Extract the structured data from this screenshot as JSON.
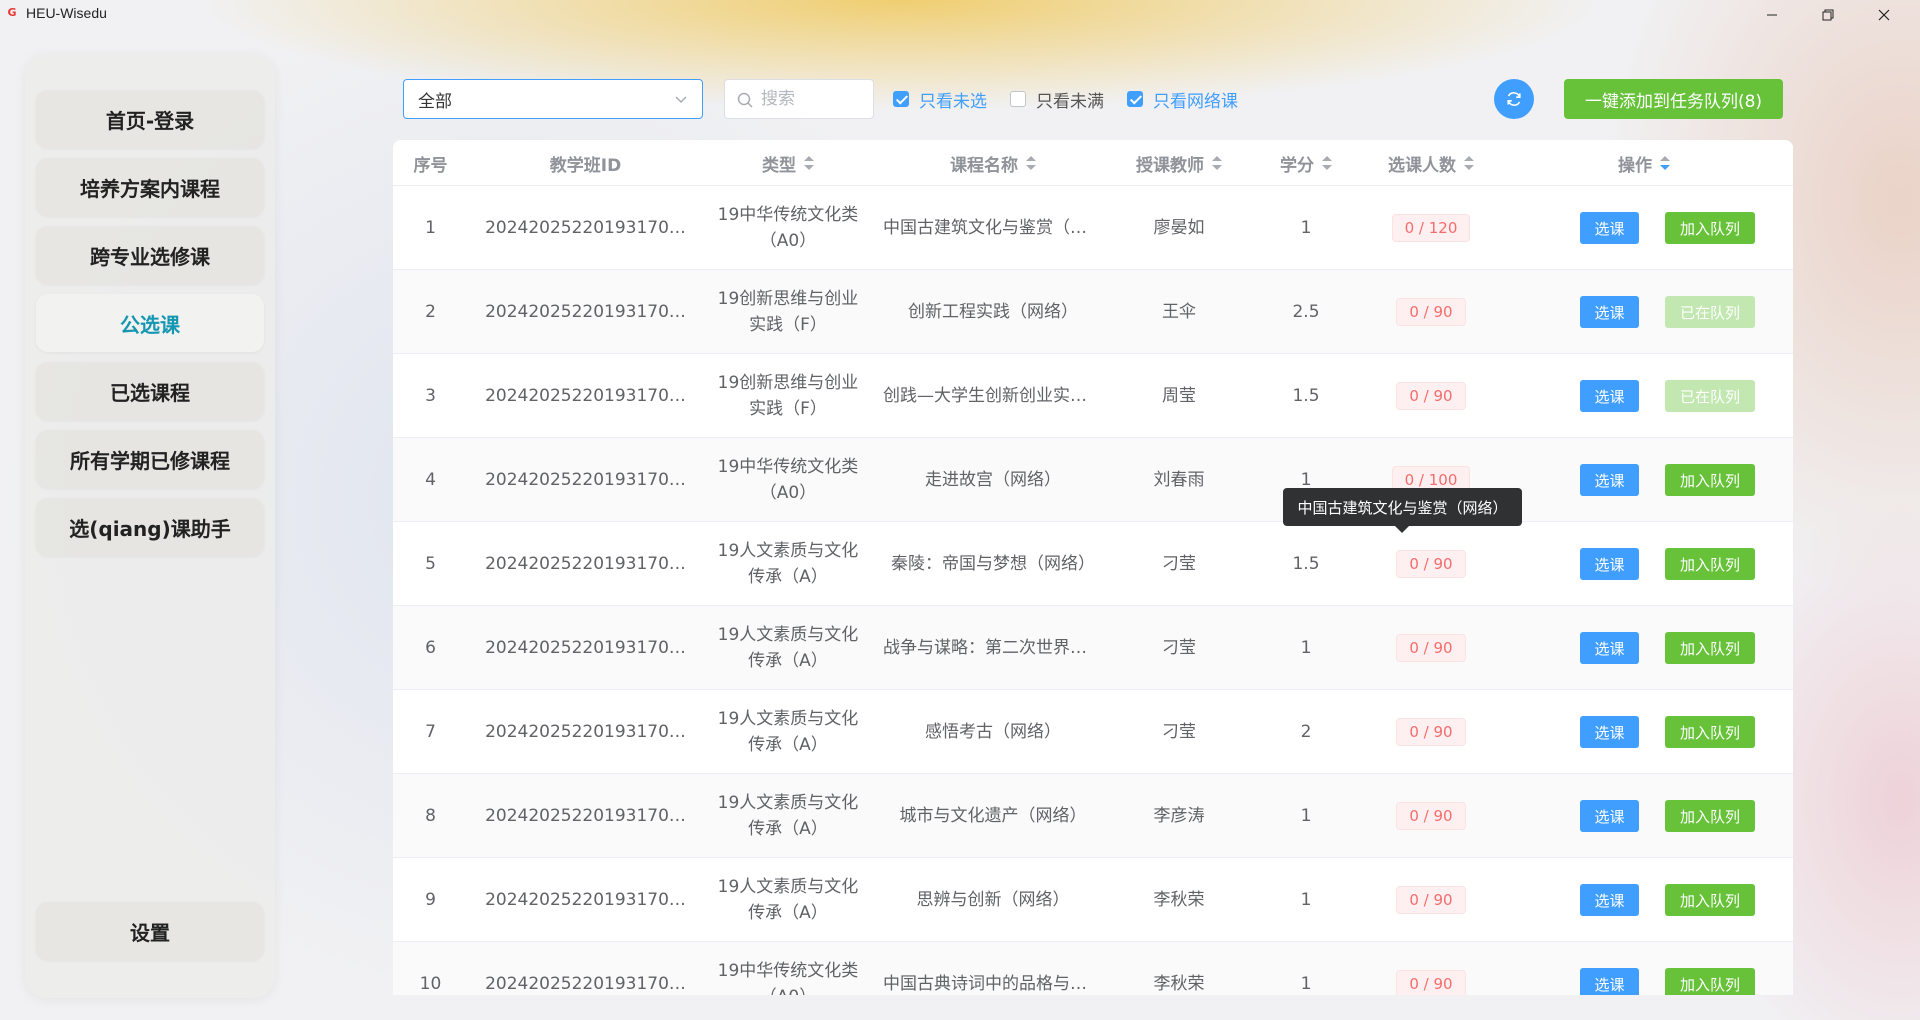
{
  "window": {
    "title": "HEU-Wisedu",
    "logo": "G"
  },
  "sidebar": {
    "items": [
      {
        "label": "首页-登录",
        "active": false
      },
      {
        "label": "培养方案内课程",
        "active": false
      },
      {
        "label": "跨专业选修课",
        "active": false
      },
      {
        "label": "公选课",
        "active": true
      },
      {
        "label": "已选课程",
        "active": false
      },
      {
        "label": "所有学期已修课程",
        "active": false
      },
      {
        "label": "选(qiang)课助手",
        "active": false
      }
    ],
    "settings_label": "设置"
  },
  "toolbar": {
    "filter_value": "全部",
    "search_placeholder": "搜索",
    "checkboxes": [
      {
        "label": "只看未选",
        "checked": true
      },
      {
        "label": "只看未满",
        "checked": false
      },
      {
        "label": "只看网络课",
        "checked": true
      }
    ],
    "queue_all_label": "一键添加到任务队列(8)"
  },
  "table": {
    "headers": {
      "idx": "序号",
      "class_id": "教学班ID",
      "type": "类型",
      "name": "课程名称",
      "teacher": "授课教师",
      "credit": "学分",
      "count": "选课人数",
      "ops": "操作"
    },
    "select_label": "选课",
    "queue_label": "加入队列",
    "queued_label": "已在队列",
    "rows": [
      {
        "idx": "1",
        "class_id": "20242025220193170…",
        "type": "19中华传统文化类（A0）",
        "name": "中国古建筑文化与鉴赏（网…",
        "teacher": "廖晏如",
        "credit": "1",
        "count": "0 / 120",
        "queued": false
      },
      {
        "idx": "2",
        "class_id": "20242025220193170…",
        "type": "19创新思维与创业实践（F）",
        "name": "创新工程实践（网络）",
        "teacher": "王伞",
        "credit": "2.5",
        "count": "0 / 90",
        "queued": true
      },
      {
        "idx": "3",
        "class_id": "20242025220193170…",
        "type": "19创新思维与创业实践（F）",
        "name": "创践—大学生创新创业实务…",
        "teacher": "周莹",
        "credit": "1.5",
        "count": "0 / 90",
        "queued": true
      },
      {
        "idx": "4",
        "class_id": "20242025220193170…",
        "type": "19中华传统文化类（A0）",
        "name": "走进故宫（网络）",
        "teacher": "刘春雨",
        "credit": "1",
        "count": "0 / 100",
        "queued": false
      },
      {
        "idx": "5",
        "class_id": "20242025220193170…",
        "type": "19人文素质与文化传承（A）",
        "name": "秦陵：帝国与梦想（网络）",
        "teacher": "刁莹",
        "credit": "1.5",
        "count": "0 / 90",
        "queued": false
      },
      {
        "idx": "6",
        "class_id": "20242025220193170…",
        "type": "19人文素质与文化传承（A）",
        "name": "战争与谋略：第二次世界大…",
        "teacher": "刁莹",
        "credit": "1",
        "count": "0 / 90",
        "queued": false
      },
      {
        "idx": "7",
        "class_id": "20242025220193170…",
        "type": "19人文素质与文化传承（A）",
        "name": "感悟考古（网络）",
        "teacher": "刁莹",
        "credit": "2",
        "count": "0 / 90",
        "queued": false
      },
      {
        "idx": "8",
        "class_id": "20242025220193170…",
        "type": "19人文素质与文化传承（A）",
        "name": "城市与文化遗产（网络）",
        "teacher": "李彦涛",
        "credit": "1",
        "count": "0 / 90",
        "queued": false
      },
      {
        "idx": "9",
        "class_id": "20242025220193170…",
        "type": "19人文素质与文化传承（A）",
        "name": "思辨与创新（网络）",
        "teacher": "李秋荣",
        "credit": "1",
        "count": "0 / 90",
        "queued": false
      },
      {
        "idx": "10",
        "class_id": "20242025220193170…",
        "type": "19中华传统文化类（A0）",
        "name": "中国古典诗词中的品格与修…",
        "teacher": "李秋荣",
        "credit": "1",
        "count": "0 / 90",
        "queued": false
      }
    ]
  },
  "tooltip": {
    "text": "中国古建筑文化与鉴赏（网络）"
  },
  "colors": {
    "accent": "#409eff",
    "success": "#67c23a",
    "active_nav": "#1597b3",
    "danger": "#f56c6c"
  },
  "icons": {
    "minimize": "minimize-icon",
    "maximize": "restore-icon",
    "close": "close-icon",
    "search": "search-icon",
    "refresh": "refresh-icon",
    "dropdown": "chevron-down-icon"
  }
}
